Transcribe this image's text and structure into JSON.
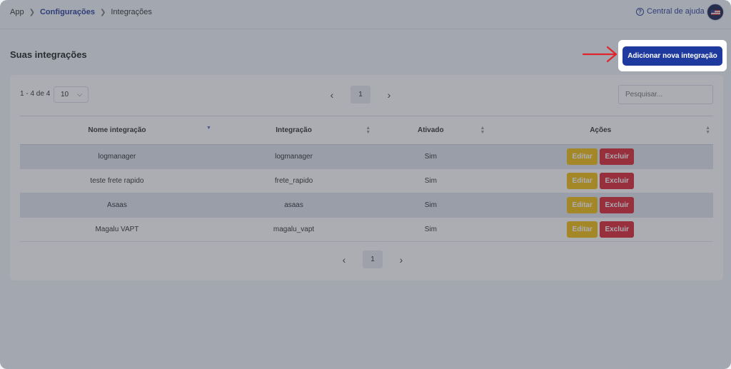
{
  "breadcrumb": {
    "items": [
      "App",
      "Configurações",
      "Integrações"
    ]
  },
  "header": {
    "help_label": "Central de ajuda",
    "help_icon": "?"
  },
  "page": {
    "title": "Suas integrações",
    "add_button": "Adicionar nova integração"
  },
  "toolbar": {
    "count_label": "1 - 4 de 4",
    "per_page": "10",
    "search_placeholder": "Pesquisar...",
    "current_page": "1"
  },
  "table": {
    "headers": [
      "Nome integração",
      "Integração",
      "Ativado",
      "Ações"
    ],
    "rows": [
      {
        "name": "logmanager",
        "integration": "logmanager",
        "active": "Sim"
      },
      {
        "name": "teste frete rapido",
        "integration": "frete_rapido",
        "active": "Sim"
      },
      {
        "name": "Asaas",
        "integration": "asaas",
        "active": "Sim"
      },
      {
        "name": "Magalu VAPT",
        "integration": "magalu_vapt",
        "active": "Sim"
      }
    ],
    "edit_label": "Editar",
    "delete_label": "Excluir"
  },
  "colors": {
    "primary": "#1e3a9f",
    "edit": "#f3bf0f",
    "delete": "#dc2735",
    "arrow": "#e0262c"
  }
}
